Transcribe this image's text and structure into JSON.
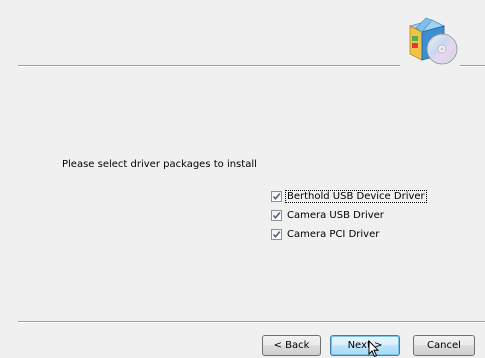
{
  "prompt_text": "Please select driver packages to install",
  "drivers": [
    {
      "label": "Berthold USB Device Driver",
      "checked": true
    },
    {
      "label": "Camera USB Driver",
      "checked": true
    },
    {
      "label": "Camera PCI Driver",
      "checked": true
    }
  ],
  "buttons": {
    "back_label": "< Back",
    "next_label": "Next >",
    "cancel_label": "Cancel"
  },
  "header": {
    "icon": "installer-box-cd-icon"
  },
  "colors": {
    "window_bg": "#f0f0f0",
    "default_button_border": "#3c7fb1",
    "checkmark": "#4d6185"
  }
}
